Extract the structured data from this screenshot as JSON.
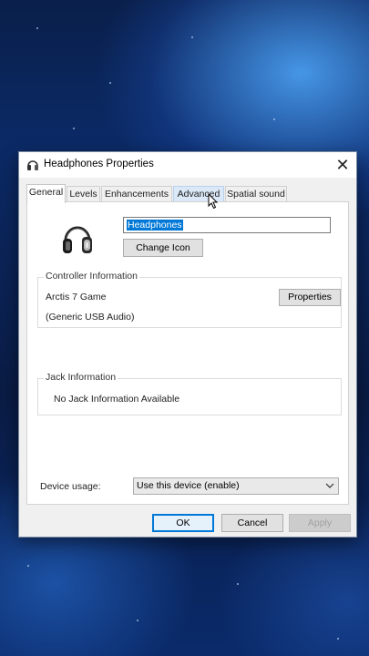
{
  "window": {
    "title": "Headphones Properties",
    "close_glyph": "✕"
  },
  "tabs": [
    {
      "label": "General",
      "active": true
    },
    {
      "label": "Levels",
      "active": false
    },
    {
      "label": "Enhancements",
      "active": false
    },
    {
      "label": "Advanced",
      "active": false,
      "hovered": true
    },
    {
      "label": "Spatial sound",
      "active": false
    }
  ],
  "general": {
    "device_name": "Headphones",
    "change_icon_label": "Change Icon",
    "controller": {
      "group_title": "Controller Information",
      "name": "Arctis 7 Game",
      "driver": "(Generic USB Audio)",
      "properties_label": "Properties"
    },
    "jack": {
      "group_title": "Jack Information",
      "status": "No Jack Information Available"
    },
    "device_usage": {
      "label": "Device usage:",
      "selected": "Use this device (enable)"
    }
  },
  "buttons": {
    "ok": "OK",
    "cancel": "Cancel",
    "apply": "Apply"
  },
  "icons": {
    "title": "headphones-icon",
    "device": "headphones-device-icon",
    "dropdown": "chevron-down-icon",
    "cursor": "mouse-cursor-icon"
  },
  "colors": {
    "accent": "#0078d7",
    "dialog_bg": "#f0f0f0",
    "panel_bg": "#ffffff"
  }
}
